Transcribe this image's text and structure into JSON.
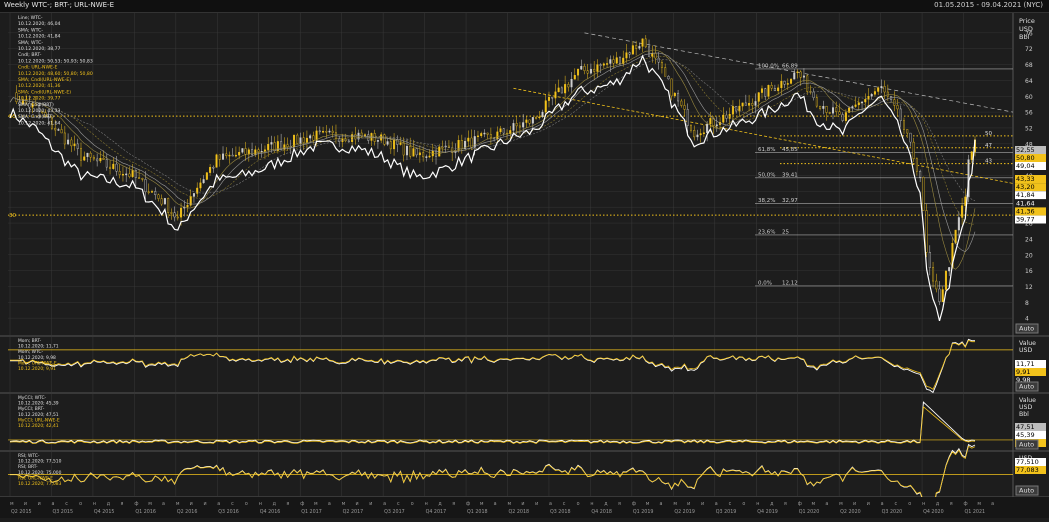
{
  "window": {
    "title": "Weekly WTC-; BRT-; URL-NWE-E",
    "date_range": "01.05.2015 - 09.04.2021 (NYC)"
  },
  "colors": {
    "background": "#1d1d1d",
    "grid": "#3a3a3a",
    "wti": "#ffffff",
    "brent": "#b8b8b8",
    "urals": "#f2c21b",
    "dotted": "#f2c21b"
  },
  "main_panel": {
    "axis_title": [
      "Price",
      "USD",
      "Bbl"
    ],
    "y_ticks": [
      "76",
      "72",
      "68",
      "64",
      "60",
      "56",
      "52",
      "48",
      "44",
      "40",
      "36",
      "32",
      "28",
      "24",
      "20",
      "16",
      "12",
      "8",
      "4"
    ],
    "legend": [
      "Line; WTC-",
      "10.12.2020; 46,04",
      "SMA; WTC-",
      "10.12.2020; 41,84",
      "SMA; WTC-",
      "10.12.2020; 38,77",
      "Cndl; BRT-",
      "10.12.2020; 50,53; 50,93; 50,83",
      "Cndl; URL-NWE-E",
      "10.12.2020; 48,60; 50,80; 50,80",
      "SMA; Cndl(URL-NWE-E)",
      "10.12.2020; 41,36",
      "SMA; Cndl(URL-NWE-E)",
      "10.12.2020; 39,77",
      "SMA; Cndl(BRT)",
      "10.12.2020; 43,33",
      "SMA; Cndl(BRT)",
      "10.12.2020; 41,64"
    ],
    "fib_levels": [
      {
        "label": "100,0%",
        "value": "66,89"
      },
      {
        "label": "61,8%",
        "value": "45,85"
      },
      {
        "label": "50,0%",
        "value": "39,41"
      },
      {
        "label": "38,2%",
        "value": "32,97"
      },
      {
        "label": "23,6%",
        "value": "25"
      },
      {
        "label": "0,0%",
        "value": "12,12"
      }
    ],
    "hline_labels": [
      "55",
      "30",
      "50",
      "47",
      "43"
    ],
    "price_badges": [
      {
        "text": "52,55",
        "bg": "#bdbdbd",
        "fg": "#000000"
      },
      {
        "text": "50,80",
        "bg": "#f2c21b",
        "fg": "#000000"
      },
      {
        "text": "49,04",
        "bg": "#ffffff",
        "fg": "#000000"
      },
      {
        "text": "43,33",
        "bg": "#f2c21b",
        "fg": "#000000"
      },
      {
        "text": "43,20",
        "bg": "#f2c21b",
        "fg": "#000000"
      },
      {
        "text": "41,84",
        "bg": "#ffffff",
        "fg": "#000000"
      },
      {
        "text": "41,64",
        "bg": "#1d1d1d",
        "fg": "#ffffff"
      },
      {
        "text": "41,36",
        "bg": "#f2c21b",
        "fg": "#000000"
      },
      {
        "text": "39,77",
        "bg": "#ffffff",
        "fg": "#000000"
      }
    ],
    "auto_label": "Auto"
  },
  "mom_panel": {
    "legend": [
      "Mom; BRT-",
      "10.12.2020; 11,71",
      "Mom; WTC-",
      "10.12.2020; 9,98",
      "Mom; URL-NWE-E",
      "10.12.2020; 9,91"
    ],
    "axis_title": [
      "Value",
      "USD"
    ],
    "badges": [
      {
        "text": "11,71",
        "bg": "#ffffff",
        "fg": "#000000"
      },
      {
        "text": "9,91",
        "bg": "#f2c21b",
        "fg": "#000000"
      },
      {
        "text": "9,98",
        "bg": "#1d1d1d",
        "fg": "#ffffff"
      }
    ],
    "auto_label": "Auto"
  },
  "macc_panel": {
    "legend": [
      "MyCCI; WTC-",
      "10.12.2020; 45,39",
      "MyCCI; BRT-",
      "10.12.2020; 47,51",
      "MyCCI; URL-NWE-E",
      "10.12.2020; 42,41"
    ],
    "axis_title": [
      "Value",
      "USD",
      "Bbl"
    ],
    "badges": [
      {
        "text": "47,51",
        "bg": "#bdbdbd",
        "fg": "#000000"
      },
      {
        "text": "45,39",
        "bg": "#ffffff",
        "fg": "#000000"
      },
      {
        "text": "42,41",
        "bg": "#f2c21b",
        "fg": "#000000"
      }
    ],
    "auto_label": "Auto"
  },
  "rsi_panel": {
    "legend": [
      "RSI; WTC-",
      "10.12.2020; 77,510",
      "RSI; BRT-",
      "10.12.2020; 75,000",
      "RSI; URL-NWE-E",
      "10.12.2020; 77,083"
    ],
    "axis_title": [
      "USD",
      "Bbl"
    ],
    "badges": [
      {
        "text": "77,510",
        "bg": "#ffffff",
        "fg": "#000000"
      },
      {
        "text": "77,083",
        "bg": "#f2c21b",
        "fg": "#000000"
      }
    ],
    "auto_label": "Auto"
  },
  "x_axis": {
    "quarters": [
      "Q2 2015",
      "Q3 2015",
      "Q4 2015",
      "Q1 2016",
      "Q2 2016",
      "Q3 2016",
      "Q4 2016",
      "Q1 2017",
      "Q2 2017",
      "Q3 2017",
      "Q4 2017",
      "Q1 2018",
      "Q2 2018",
      "Q3 2018",
      "Q4 2018",
      "Q1 2019",
      "Q2 2019",
      "Q3 2019",
      "Q4 2019",
      "Q1 2020",
      "Q2 2020",
      "Q3 2020",
      "Q4 2020",
      "Q1 2021"
    ],
    "months_cycle": [
      "м",
      "и",
      "и",
      "а",
      "с",
      "о",
      "н",
      "д",
      "я",
      "ф",
      "м",
      "а"
    ]
  }
}
